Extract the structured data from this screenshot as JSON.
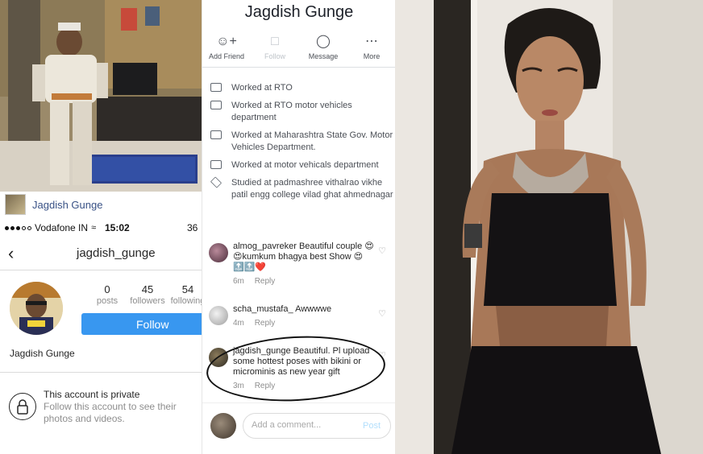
{
  "left": {
    "caption_name": "Jagdish Gunge",
    "status": {
      "carrier": "Vodafone IN",
      "time": "15:02",
      "battery": "36"
    },
    "profile": {
      "username": "jagdish_gunge",
      "back_icon": "chevron-left-icon",
      "posts_count": "0",
      "posts_label": "posts",
      "followers_count": "45",
      "followers_label": "followers",
      "following_count": "54",
      "following_label": "following",
      "follow_label": "Follow",
      "display_name": "Jagdish Gunge"
    },
    "private": {
      "title": "This account is private",
      "subtitle": "Follow this account to see their photos and videos.",
      "icon": "lock-icon"
    }
  },
  "middle": {
    "profile_name": "Jagdish Gunge",
    "actions": [
      {
        "label": "Add Friend",
        "icon": "add-friend-icon",
        "disabled": false
      },
      {
        "label": "Follow",
        "icon": "follow-icon",
        "disabled": true
      },
      {
        "label": "Message",
        "icon": "messenger-icon",
        "disabled": false
      },
      {
        "label": "More",
        "icon": "more-icon",
        "disabled": false
      }
    ],
    "about": [
      {
        "text": "Worked at RTO",
        "icon": "briefcase-icon"
      },
      {
        "text": "Worked at RTO motor vehicles department",
        "icon": "briefcase-icon"
      },
      {
        "text": "Worked at Maharashtra State Gov. Motor Vehicles Department.",
        "icon": "briefcase-icon"
      },
      {
        "text": "Worked at motor vehicals department",
        "icon": "briefcase-icon"
      },
      {
        "text": "Studied at padmashree vithalrao vikhe patil engg college vilad ghat ahmednagar",
        "icon": "graduation-cap-icon"
      }
    ],
    "comments": [
      {
        "user": "almog_pavreker",
        "text": "Beautiful couple 😍😍kumkum bhagya best Show 😍🔝🔝❤️",
        "time": "6m",
        "reply": "Reply"
      },
      {
        "user": "scha_mustafa_",
        "text": "Awwwwe",
        "time": "4m",
        "reply": "Reply"
      },
      {
        "user": "jagdish_gunge",
        "text": "Beautiful. Pl upload some hottest poses with bikini or microminis as new year gift",
        "time": "3m",
        "reply": "Reply"
      }
    ],
    "add_comment_placeholder": "Add a comment...",
    "post_label": "Post"
  },
  "colors": {
    "instagram_blue": "#3897f0",
    "fb_text": "#4b4f56",
    "muted": "#8e8e8e"
  }
}
